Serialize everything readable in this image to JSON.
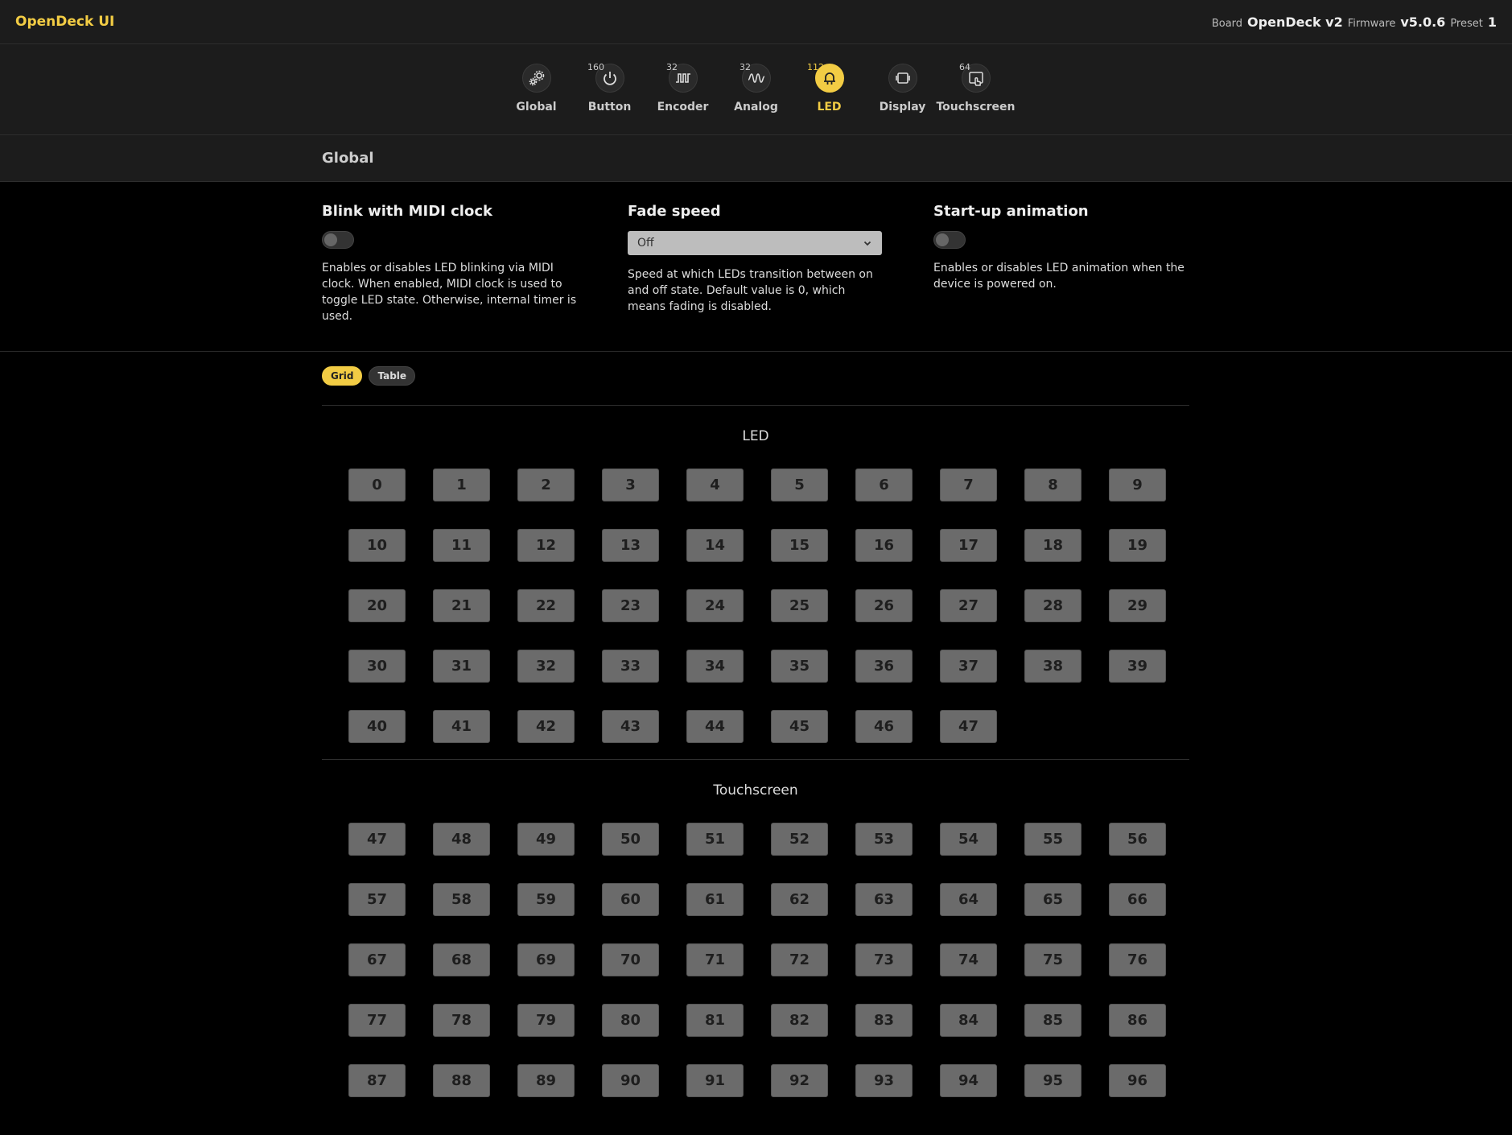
{
  "app": {
    "title": "OpenDeck UI"
  },
  "device": {
    "board_label": "Board",
    "board_value": "OpenDeck v2",
    "firmware_label": "Firmware",
    "firmware_value": "v5.0.6",
    "preset_label": "Preset",
    "preset_value": "1"
  },
  "nav": [
    {
      "label": "Global",
      "count": "",
      "icon": "gears-icon"
    },
    {
      "label": "Button",
      "count": "160",
      "icon": "power-icon"
    },
    {
      "label": "Encoder",
      "count": "32",
      "icon": "square-wave-icon"
    },
    {
      "label": "Analog",
      "count": "32",
      "icon": "sine-wave-icon"
    },
    {
      "label": "LED",
      "count": "112",
      "icon": "bell-icon",
      "active": true
    },
    {
      "label": "Display",
      "count": "",
      "icon": "display-icon"
    },
    {
      "label": "Touchscreen",
      "count": "64",
      "icon": "touch-icon"
    }
  ],
  "section": {
    "title": "Global"
  },
  "settings": {
    "blink": {
      "title": "Blink with MIDI clock",
      "description": "Enables or disables LED blinking via MIDI clock. When enabled, MIDI clock is used to toggle LED state. Otherwise, internal timer is used."
    },
    "fade": {
      "title": "Fade speed",
      "value": "Off",
      "description": "Speed at which LEDs transition between on and off state. Default value is 0, which means fading is disabled."
    },
    "startup": {
      "title": "Start-up animation",
      "description": "Enables or disables LED animation when the device is powered on."
    }
  },
  "views": {
    "grid": "Grid",
    "table": "Table"
  },
  "groups": {
    "led": {
      "title": "LED",
      "items": [
        "0",
        "1",
        "2",
        "3",
        "4",
        "5",
        "6",
        "7",
        "8",
        "9",
        "10",
        "11",
        "12",
        "13",
        "14",
        "15",
        "16",
        "17",
        "18",
        "19",
        "20",
        "21",
        "22",
        "23",
        "24",
        "25",
        "26",
        "27",
        "28",
        "29",
        "30",
        "31",
        "32",
        "33",
        "34",
        "35",
        "36",
        "37",
        "38",
        "39",
        "40",
        "41",
        "42",
        "43",
        "44",
        "45",
        "46",
        "47"
      ]
    },
    "touchscreen": {
      "title": "Touchscreen",
      "items": [
        "47",
        "48",
        "49",
        "50",
        "51",
        "52",
        "53",
        "54",
        "55",
        "56",
        "57",
        "58",
        "59",
        "60",
        "61",
        "62",
        "63",
        "64",
        "65",
        "66",
        "67",
        "68",
        "69",
        "70",
        "71",
        "72",
        "73",
        "74",
        "75",
        "76",
        "77",
        "78",
        "79",
        "80",
        "81",
        "82",
        "83",
        "84",
        "85",
        "86",
        "87",
        "88",
        "89",
        "90",
        "91",
        "92",
        "93",
        "94",
        "95",
        "96"
      ]
    }
  },
  "colors": {
    "accent": "#f2cc44",
    "cell": "#6b6b6b",
    "bar": "#1c1c1c"
  }
}
